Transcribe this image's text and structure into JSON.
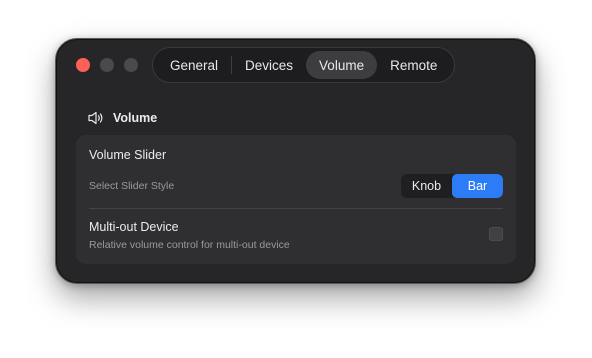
{
  "tabs": [
    {
      "label": "General"
    },
    {
      "label": "Devices"
    },
    {
      "label": "Volume",
      "active": true
    },
    {
      "label": "Remote"
    }
  ],
  "section": {
    "title": "Volume",
    "icon": "speaker-icon"
  },
  "volume_slider": {
    "title": "Volume Slider",
    "subtitle": "Select Slider Style",
    "options": [
      "Knob",
      "Bar"
    ],
    "selected": "Bar"
  },
  "multi_out": {
    "title": "Multi-out Device",
    "subtitle": "Relative volume control for multi-out device",
    "checked": false
  },
  "colors": {
    "accent": "#2b7cf6",
    "close": "#fe5f57",
    "window_bg": "#262628",
    "card_bg": "#2f2f32"
  }
}
